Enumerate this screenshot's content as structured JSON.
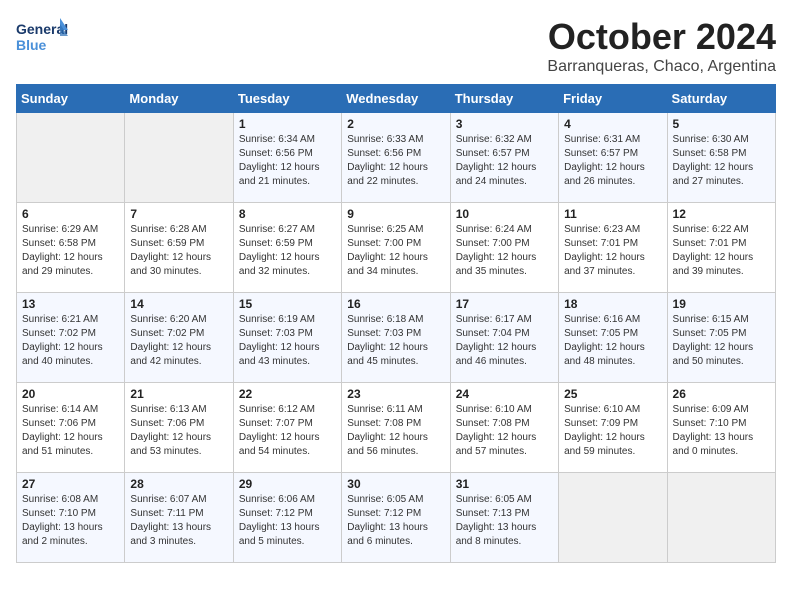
{
  "logo": {
    "general": "General",
    "blue": "Blue"
  },
  "title": "October 2024",
  "location": "Barranqueras, Chaco, Argentina",
  "headers": [
    "Sunday",
    "Monday",
    "Tuesday",
    "Wednesday",
    "Thursday",
    "Friday",
    "Saturday"
  ],
  "weeks": [
    [
      {
        "day": "",
        "info": ""
      },
      {
        "day": "",
        "info": ""
      },
      {
        "day": "1",
        "info": "Sunrise: 6:34 AM\nSunset: 6:56 PM\nDaylight: 12 hours and 21 minutes."
      },
      {
        "day": "2",
        "info": "Sunrise: 6:33 AM\nSunset: 6:56 PM\nDaylight: 12 hours and 22 minutes."
      },
      {
        "day": "3",
        "info": "Sunrise: 6:32 AM\nSunset: 6:57 PM\nDaylight: 12 hours and 24 minutes."
      },
      {
        "day": "4",
        "info": "Sunrise: 6:31 AM\nSunset: 6:57 PM\nDaylight: 12 hours and 26 minutes."
      },
      {
        "day": "5",
        "info": "Sunrise: 6:30 AM\nSunset: 6:58 PM\nDaylight: 12 hours and 27 minutes."
      }
    ],
    [
      {
        "day": "6",
        "info": "Sunrise: 6:29 AM\nSunset: 6:58 PM\nDaylight: 12 hours and 29 minutes."
      },
      {
        "day": "7",
        "info": "Sunrise: 6:28 AM\nSunset: 6:59 PM\nDaylight: 12 hours and 30 minutes."
      },
      {
        "day": "8",
        "info": "Sunrise: 6:27 AM\nSunset: 6:59 PM\nDaylight: 12 hours and 32 minutes."
      },
      {
        "day": "9",
        "info": "Sunrise: 6:25 AM\nSunset: 7:00 PM\nDaylight: 12 hours and 34 minutes."
      },
      {
        "day": "10",
        "info": "Sunrise: 6:24 AM\nSunset: 7:00 PM\nDaylight: 12 hours and 35 minutes."
      },
      {
        "day": "11",
        "info": "Sunrise: 6:23 AM\nSunset: 7:01 PM\nDaylight: 12 hours and 37 minutes."
      },
      {
        "day": "12",
        "info": "Sunrise: 6:22 AM\nSunset: 7:01 PM\nDaylight: 12 hours and 39 minutes."
      }
    ],
    [
      {
        "day": "13",
        "info": "Sunrise: 6:21 AM\nSunset: 7:02 PM\nDaylight: 12 hours and 40 minutes."
      },
      {
        "day": "14",
        "info": "Sunrise: 6:20 AM\nSunset: 7:02 PM\nDaylight: 12 hours and 42 minutes."
      },
      {
        "day": "15",
        "info": "Sunrise: 6:19 AM\nSunset: 7:03 PM\nDaylight: 12 hours and 43 minutes."
      },
      {
        "day": "16",
        "info": "Sunrise: 6:18 AM\nSunset: 7:03 PM\nDaylight: 12 hours and 45 minutes."
      },
      {
        "day": "17",
        "info": "Sunrise: 6:17 AM\nSunset: 7:04 PM\nDaylight: 12 hours and 46 minutes."
      },
      {
        "day": "18",
        "info": "Sunrise: 6:16 AM\nSunset: 7:05 PM\nDaylight: 12 hours and 48 minutes."
      },
      {
        "day": "19",
        "info": "Sunrise: 6:15 AM\nSunset: 7:05 PM\nDaylight: 12 hours and 50 minutes."
      }
    ],
    [
      {
        "day": "20",
        "info": "Sunrise: 6:14 AM\nSunset: 7:06 PM\nDaylight: 12 hours and 51 minutes."
      },
      {
        "day": "21",
        "info": "Sunrise: 6:13 AM\nSunset: 7:06 PM\nDaylight: 12 hours and 53 minutes."
      },
      {
        "day": "22",
        "info": "Sunrise: 6:12 AM\nSunset: 7:07 PM\nDaylight: 12 hours and 54 minutes."
      },
      {
        "day": "23",
        "info": "Sunrise: 6:11 AM\nSunset: 7:08 PM\nDaylight: 12 hours and 56 minutes."
      },
      {
        "day": "24",
        "info": "Sunrise: 6:10 AM\nSunset: 7:08 PM\nDaylight: 12 hours and 57 minutes."
      },
      {
        "day": "25",
        "info": "Sunrise: 6:10 AM\nSunset: 7:09 PM\nDaylight: 12 hours and 59 minutes."
      },
      {
        "day": "26",
        "info": "Sunrise: 6:09 AM\nSunset: 7:10 PM\nDaylight: 13 hours and 0 minutes."
      }
    ],
    [
      {
        "day": "27",
        "info": "Sunrise: 6:08 AM\nSunset: 7:10 PM\nDaylight: 13 hours and 2 minutes."
      },
      {
        "day": "28",
        "info": "Sunrise: 6:07 AM\nSunset: 7:11 PM\nDaylight: 13 hours and 3 minutes."
      },
      {
        "day": "29",
        "info": "Sunrise: 6:06 AM\nSunset: 7:12 PM\nDaylight: 13 hours and 5 minutes."
      },
      {
        "day": "30",
        "info": "Sunrise: 6:05 AM\nSunset: 7:12 PM\nDaylight: 13 hours and 6 minutes."
      },
      {
        "day": "31",
        "info": "Sunrise: 6:05 AM\nSunset: 7:13 PM\nDaylight: 13 hours and 8 minutes."
      },
      {
        "day": "",
        "info": ""
      },
      {
        "day": "",
        "info": ""
      }
    ]
  ]
}
